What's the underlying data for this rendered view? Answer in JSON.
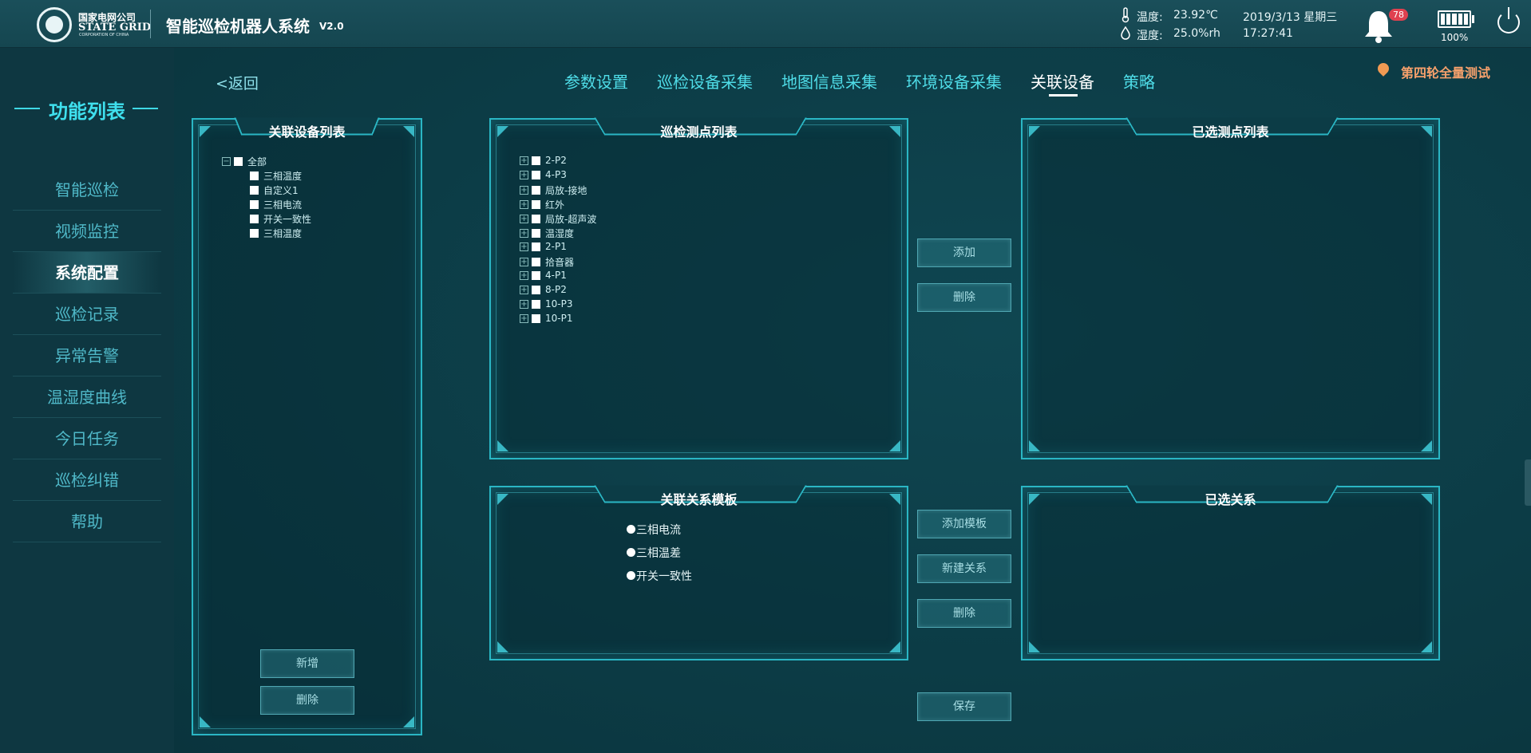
{
  "header": {
    "logo_cn": "国家电网公司",
    "logo_en": "STATE GRID",
    "logo_corp": "CORPORATION OF CHINA",
    "title": "智能巡检机器人系统",
    "version": "V2.0",
    "temp_label": "温度:",
    "temp_value": "23.92℃",
    "humidity_label": "湿度:",
    "humidity_value": "25.0%rh",
    "date": "2019/3/13 星期三",
    "time": "17:27:41",
    "alarm_count": "78",
    "battery": "100%"
  },
  "sidebar": {
    "title": "功能列表",
    "items": [
      {
        "label": "智能巡检"
      },
      {
        "label": "视频监控"
      },
      {
        "label": "系统配置",
        "active": true
      },
      {
        "label": "巡检记录"
      },
      {
        "label": "异常告警"
      },
      {
        "label": "温湿度曲线"
      },
      {
        "label": "今日任务"
      },
      {
        "label": "巡检纠错"
      },
      {
        "label": "帮助"
      }
    ]
  },
  "nav": {
    "back": "<返回",
    "tabs": [
      {
        "label": "参数设置"
      },
      {
        "label": "巡检设备采集"
      },
      {
        "label": "地图信息采集"
      },
      {
        "label": "环境设备采集"
      },
      {
        "label": "关联设备",
        "active": true
      },
      {
        "label": "策略"
      }
    ],
    "location": "第四轮全量测试"
  },
  "device_panel": {
    "title": "关联设备列表",
    "root": "全部",
    "children": [
      "三相温度",
      "自定义1",
      "三相电流",
      "开关一致性",
      "三相温度"
    ],
    "add_btn": "新增",
    "delete_btn": "删除"
  },
  "points_panel": {
    "title": "巡检测点列表",
    "items": [
      "2-P2",
      "4-P3",
      "局放-接地",
      "红外",
      "局放-超声波",
      "温湿度",
      "2-P1",
      "拾音器",
      "4-P1",
      "8-P2",
      "10-P3",
      "10-P1"
    ]
  },
  "selected_panel": {
    "title": "已选测点列表"
  },
  "mid_buttons": {
    "add": "添加",
    "delete": "删除"
  },
  "template_panel": {
    "title": "关联关系模板",
    "items": [
      "三相电流",
      "三相温差",
      "开关一致性"
    ]
  },
  "relation_buttons": {
    "add_template": "添加模板",
    "new_relation": "新建关系",
    "delete": "删除"
  },
  "relation_panel": {
    "title": "已选关系"
  },
  "save": "保存"
}
